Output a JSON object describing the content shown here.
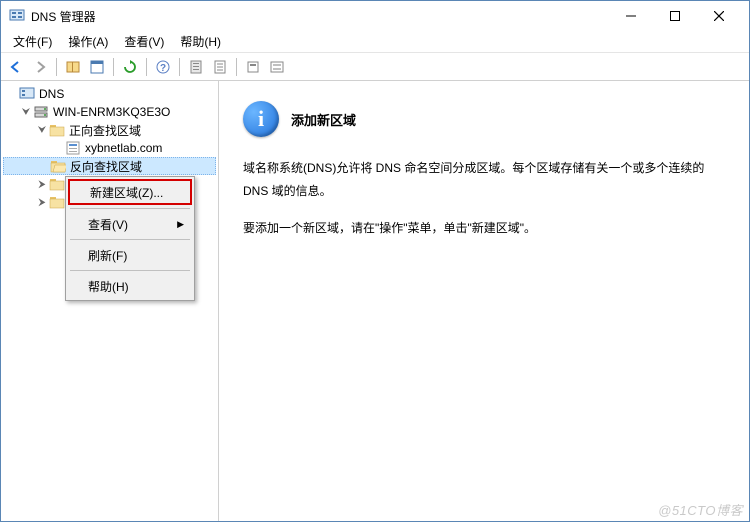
{
  "window": {
    "title": "DNS 管理器"
  },
  "menubar": {
    "file": "文件(F)",
    "action": "操作(A)",
    "view": "查看(V)",
    "help": "帮助(H)"
  },
  "tree": {
    "root": "DNS",
    "server": "WIN-ENRM3KQ3E3O",
    "forward": "正向查找区域",
    "forward_domain": "xybnetlab.com",
    "reverse": "反向查找区域"
  },
  "context_menu": {
    "new_zone": "新建区域(Z)...",
    "view": "查看(V)",
    "refresh": "刷新(F)",
    "help": "帮助(H)"
  },
  "detail": {
    "title": "添加新区域",
    "para1": "域名称系统(DNS)允许将 DNS 命名空间分成区域。每个区域存储有关一个或多个连续的 DNS 域的信息。",
    "para2": "要添加一个新区域，请在\"操作\"菜单，单击\"新建区域\"。"
  },
  "watermark": "@51CTO博客"
}
